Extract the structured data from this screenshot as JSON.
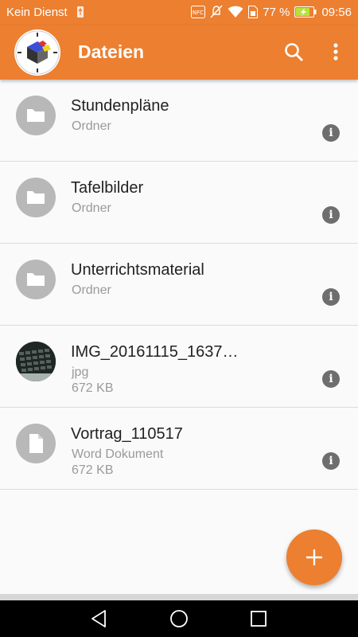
{
  "status_bar": {
    "carrier": "Kein Dienst",
    "icons": [
      "usb-icon",
      "nfc-icon",
      "mute-icon",
      "wifi-icon",
      "sim-icon",
      "battery-charging-icon"
    ],
    "nfc_label": "NFC",
    "battery": "77 %",
    "time": "09:56"
  },
  "app_bar": {
    "title": "Dateien",
    "logo": "app-logo-icon",
    "actions": [
      "search-icon",
      "more-vert-icon"
    ]
  },
  "files": [
    {
      "name": "Stundenpläne",
      "type": "Ordner",
      "size": "",
      "icon": "folder-icon"
    },
    {
      "name": "Tafelbilder",
      "type": "Ordner",
      "size": "",
      "icon": "folder-icon"
    },
    {
      "name": "Unterrichtsmaterial",
      "type": "Ordner",
      "size": "",
      "icon": "folder-icon"
    },
    {
      "name": "IMG_20161115_1637…",
      "type": "jpg",
      "size": "672 KB",
      "icon": "image-thumbnail"
    },
    {
      "name": "Vortrag_110517",
      "type": "Word Dokument",
      "size": "672 KB",
      "icon": "document-icon"
    }
  ],
  "fab": {
    "icon": "plus-icon"
  },
  "nav_bar": {
    "icons": [
      "back-icon",
      "home-icon",
      "recents-icon"
    ]
  },
  "colors": {
    "accent": "#ec7f30",
    "icon_bg": "#b8b8b8",
    "info": "#6e6e6e"
  }
}
